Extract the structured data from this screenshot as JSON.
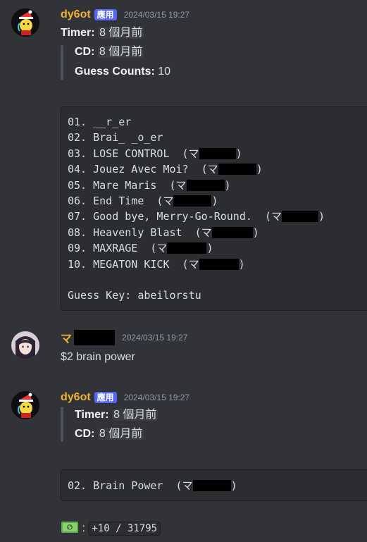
{
  "messages": {
    "m1": {
      "username": "dy6ot",
      "app_tag": "應用",
      "timestamp": "2024/03/15 19:27",
      "timer_label": "Timer:",
      "timer_value": "8 個月前",
      "cd_label": "CD:",
      "cd_value": "8 個月前",
      "guess_label": "Guess Counts:",
      "guess_value": "10",
      "code_lines": [
        "01. __r_er",
        "02. Brai_ _o_er",
        "03. LOSE CONTROL  (マ",
        "04. Jouez Avec Moi?  (マ",
        "05. Mare Maris  (マ",
        "06. End Time  (マ",
        "07. Good bye, Merry-Go-Round.  (マ",
        "08. Heavenly Blast  (マ",
        "09. MAXRAGE  (マ",
        "10. MEGATON KICK  (マ"
      ],
      "close_paren": ")",
      "guess_key": "Guess Key: abeilorstu"
    },
    "m2": {
      "username_prefix": "マ",
      "timestamp": "2024/03/15 19:27",
      "content": "$2 brain power"
    },
    "m3": {
      "username": "dy6ot",
      "app_tag": "應用",
      "timestamp": "2024/03/15 19:27",
      "timer_label": "Timer:",
      "timer_value": "8 個月前",
      "cd_label": "CD:",
      "cd_value": "8 個月前",
      "code_line": "02. Brain Power  (マ",
      "close_paren": ")",
      "money_sep": ":",
      "points": "+10 / 31795"
    }
  },
  "colors": {
    "background": "#313338",
    "bot_name": "#f0b232",
    "app_tag": "#5865f2"
  },
  "icons": [
    "bot-avatar",
    "user-avatar",
    "money-icon"
  ]
}
